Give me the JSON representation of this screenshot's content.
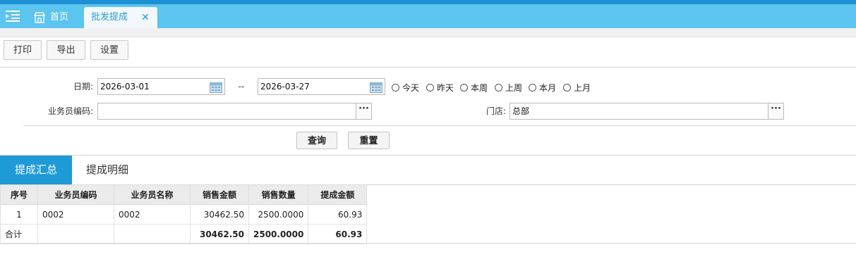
{
  "tabs": {
    "home_label": "首页",
    "active_label": "批发提成",
    "close_glyph": "✕"
  },
  "toolbar": {
    "print_label": "打印",
    "export_label": "导出",
    "settings_label": "设置"
  },
  "filters": {
    "date_label": "日期:",
    "date_from": "2026-03-01",
    "date_sep": "--",
    "date_to": "2026-03-27",
    "quick_dates": [
      "今天",
      "昨天",
      "本周",
      "上周",
      "本月",
      "上月"
    ],
    "salesman_label": "业务员编码:",
    "salesman_value": "",
    "store_label": "门店:",
    "store_value": "总部",
    "picker_glyph": "···"
  },
  "actions": {
    "query_label": "查询",
    "reset_label": "重置"
  },
  "subtabs": {
    "summary_label": "提成汇总",
    "detail_label": "提成明细"
  },
  "table": {
    "headers": [
      "序号",
      "业务员编码",
      "业务员名称",
      "销售金额",
      "销售数量",
      "提成金额"
    ],
    "rows": [
      [
        "1",
        "0002",
        "0002",
        "30462.50",
        "2500.0000",
        "60.93"
      ]
    ],
    "total": [
      "合计",
      "",
      "",
      "30462.50",
      "2500.0000",
      "60.93"
    ]
  },
  "colors": {
    "tabbar": "#5bc4ef",
    "accent": "#1e9ad6"
  }
}
